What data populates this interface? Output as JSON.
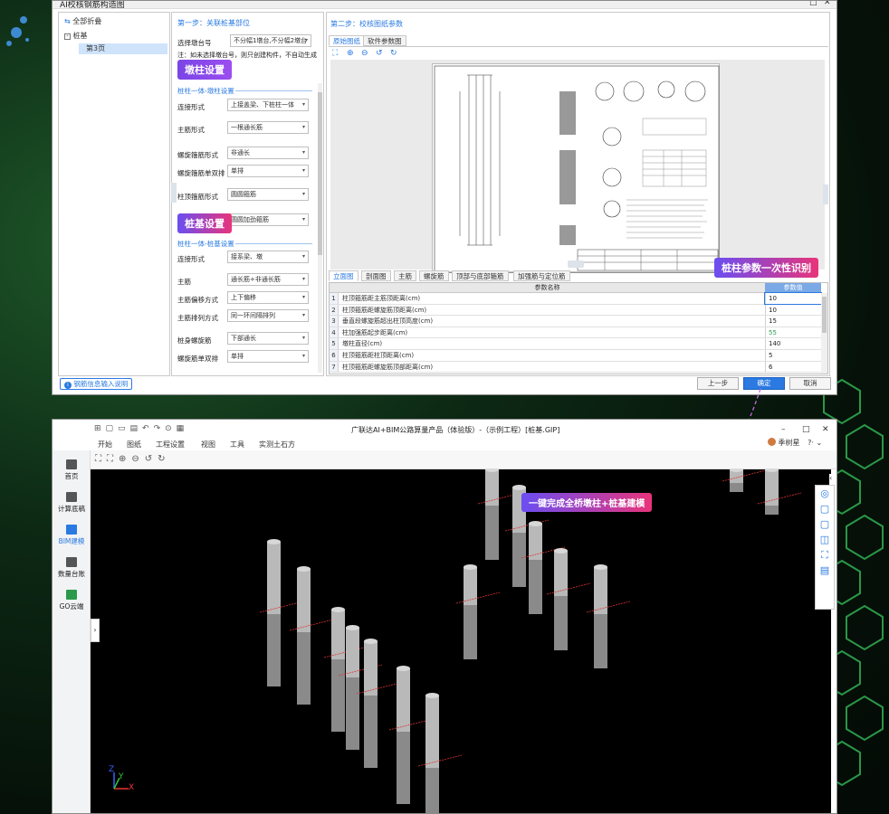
{
  "dialog": {
    "title": "AI校核钢筋构造图",
    "tree": {
      "collapse_all": "全部折叠",
      "root": "桩基",
      "child": "第3页"
    },
    "step1": {
      "title": "第一步：关联桩基部位",
      "pier_label": "选择墩台号",
      "pier_value": "不分幅1墩台,不分幅2墩台",
      "note": "注：如未选择墩台号，则只创建构件，不自动生成",
      "section1": "桩柱一体-墩柱设置",
      "rows1": [
        {
          "label": "连接形式",
          "value": "上接盖梁、下桩柱一体"
        },
        {
          "label": "主筋形式",
          "value": "一根通长筋"
        },
        {
          "label": "螺旋箍筋形式",
          "value": "非通长"
        },
        {
          "label": "螺旋箍筋单双排",
          "value": "单排"
        },
        {
          "label": "柱顶箍筋形式",
          "value": "圆圆箍筋"
        },
        {
          "label": "",
          "value": "圆圆加劲箍筋"
        }
      ],
      "section2": "桩柱一体-桩基设置",
      "rows2": [
        {
          "label": "连接形式",
          "value": "接系梁、墩"
        },
        {
          "label": "主筋",
          "value": "通长筋+非通长筋"
        },
        {
          "label": "主筋偏移方式",
          "value": "上下偏移"
        },
        {
          "label": "主筋排列方式",
          "value": "同一环间隔排列"
        },
        {
          "label": "桩身螺旋筋",
          "value": "下部通长"
        },
        {
          "label": "螺旋筋单双排",
          "value": "单排"
        }
      ]
    },
    "step2": {
      "title": "第二步：校核图纸参数",
      "tabs": [
        "原始图纸",
        "软件参数图"
      ],
      "bottom_tabs": [
        "立面图",
        "剖面图",
        "主筋",
        "螺旋筋",
        "顶部与底部箍筋",
        "加强筋与定位筋"
      ],
      "table_header_name": "参数名称",
      "table_header_value": "参数值",
      "rows": [
        {
          "n": "1",
          "name": "柱顶箍筋距主筋顶距离(cm)",
          "value": "10"
        },
        {
          "n": "2",
          "name": "柱顶箍筋距螺旋筋顶距离(cm)",
          "value": "10"
        },
        {
          "n": "3",
          "name": "垂直段螺旋筋超出柱顶高度(cm)",
          "value": "15"
        },
        {
          "n": "4",
          "name": "柱加强筋起步距离(cm)",
          "value": "55"
        },
        {
          "n": "5",
          "name": "墩柱直径(cm)",
          "value": "140"
        },
        {
          "n": "6",
          "name": "柱顶箍筋距柱顶距离(cm)",
          "value": "5"
        },
        {
          "n": "7",
          "name": "柱顶箍筋距螺旋筋顶部距离(cm)",
          "value": "6"
        }
      ]
    },
    "help_link": "钢筋信息输入说明",
    "buttons": {
      "prev": "上一步",
      "ok": "确定",
      "cancel": "取消"
    }
  },
  "badges": {
    "pier": "墩柱设置",
    "pile": "桩基设置",
    "params": "桩柱参数一次性识别",
    "build": "一键完成全桥墩柱+桩基建模"
  },
  "app": {
    "title": "广联达AI+BIM公路算量产品（体验版）-（示例工程）[桩基.GIP]",
    "menu": [
      "开始",
      "图纸",
      "工程设置",
      "视图",
      "工具",
      "实测土石方"
    ],
    "user": "季树星",
    "nav": [
      "首页",
      "计算底稿",
      "BIM建模",
      "数量台账",
      "GO云端"
    ],
    "axis_x": "X",
    "axis_y": "Y",
    "axis_z": "Z"
  },
  "colors": {
    "accent": "#2a7ae2",
    "purple": "#7a45e6",
    "pink": "#e8347a",
    "green": "#2a9a4a"
  }
}
